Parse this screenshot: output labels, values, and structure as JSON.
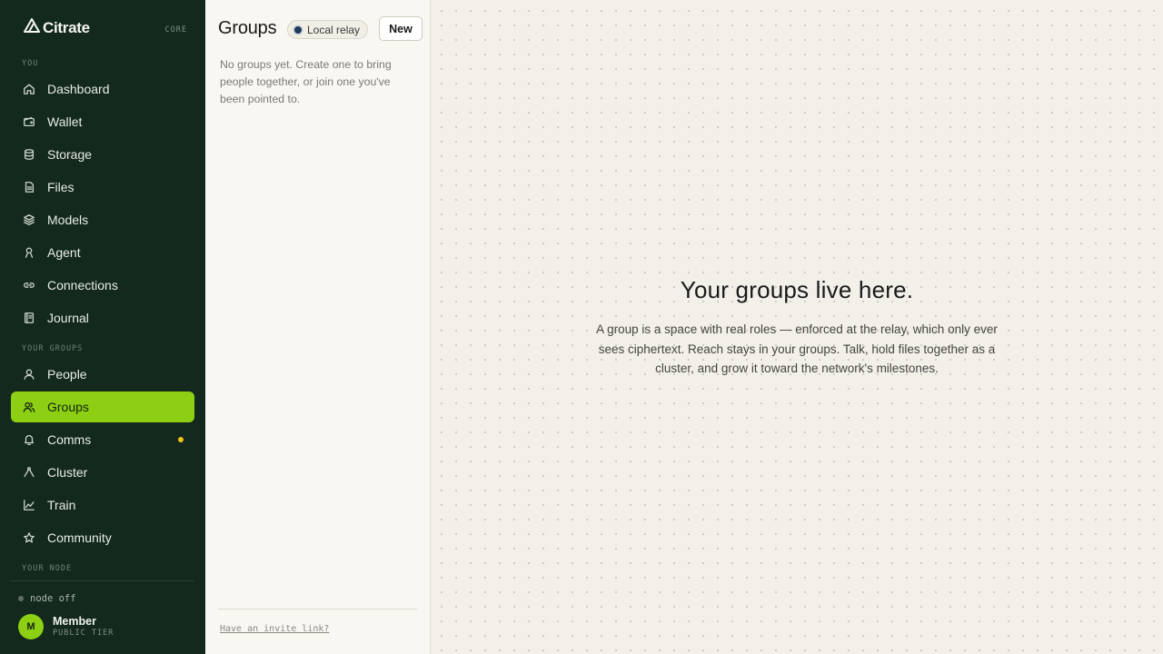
{
  "brand": {
    "name": "Citrate",
    "tag": "CORE"
  },
  "sidebar": {
    "sections": {
      "you": "YOU",
      "groups": "YOUR GROUPS",
      "node": "YOUR NODE"
    },
    "items": [
      {
        "label": "Dashboard",
        "icon": "home-icon"
      },
      {
        "label": "Wallet",
        "icon": "wallet-icon"
      },
      {
        "label": "Storage",
        "icon": "database-icon"
      },
      {
        "label": "Files",
        "icon": "file-icon"
      },
      {
        "label": "Models",
        "icon": "layers-icon"
      },
      {
        "label": "Agent",
        "icon": "agent-icon"
      },
      {
        "label": "Connections",
        "icon": "link-icon"
      },
      {
        "label": "Journal",
        "icon": "journal-icon"
      },
      {
        "label": "People",
        "icon": "person-icon"
      },
      {
        "label": "Groups",
        "icon": "users-icon",
        "active": true
      },
      {
        "label": "Comms",
        "icon": "bell-icon",
        "badge_color": "#f2c319"
      },
      {
        "label": "Cluster",
        "icon": "cluster-icon"
      },
      {
        "label": "Train",
        "icon": "chart-line-icon"
      },
      {
        "label": "Community",
        "icon": "star-icon"
      }
    ],
    "node_status": "node off",
    "user": {
      "initial": "M",
      "name": "Member",
      "tier": "PUBLIC TIER"
    }
  },
  "groups_panel": {
    "title": "Groups",
    "relay_label": "Local relay",
    "new_button": "New",
    "empty_text": "No groups yet. Create one to bring people together, or join one you've been pointed to.",
    "invite_link": "Have an invite link?"
  },
  "main": {
    "title": "Your groups live here.",
    "body": "A group is a space with real roles — enforced at the relay, which only ever sees ciphertext. Reach stays in your groups. Talk, hold files together as a cluster, and grow it toward the network's milestones."
  },
  "colors": {
    "sidebar_bg": "#14291d",
    "accent": "#8ccf13",
    "notification": "#f2c319",
    "canvas_bg": "#f3f0e9"
  }
}
